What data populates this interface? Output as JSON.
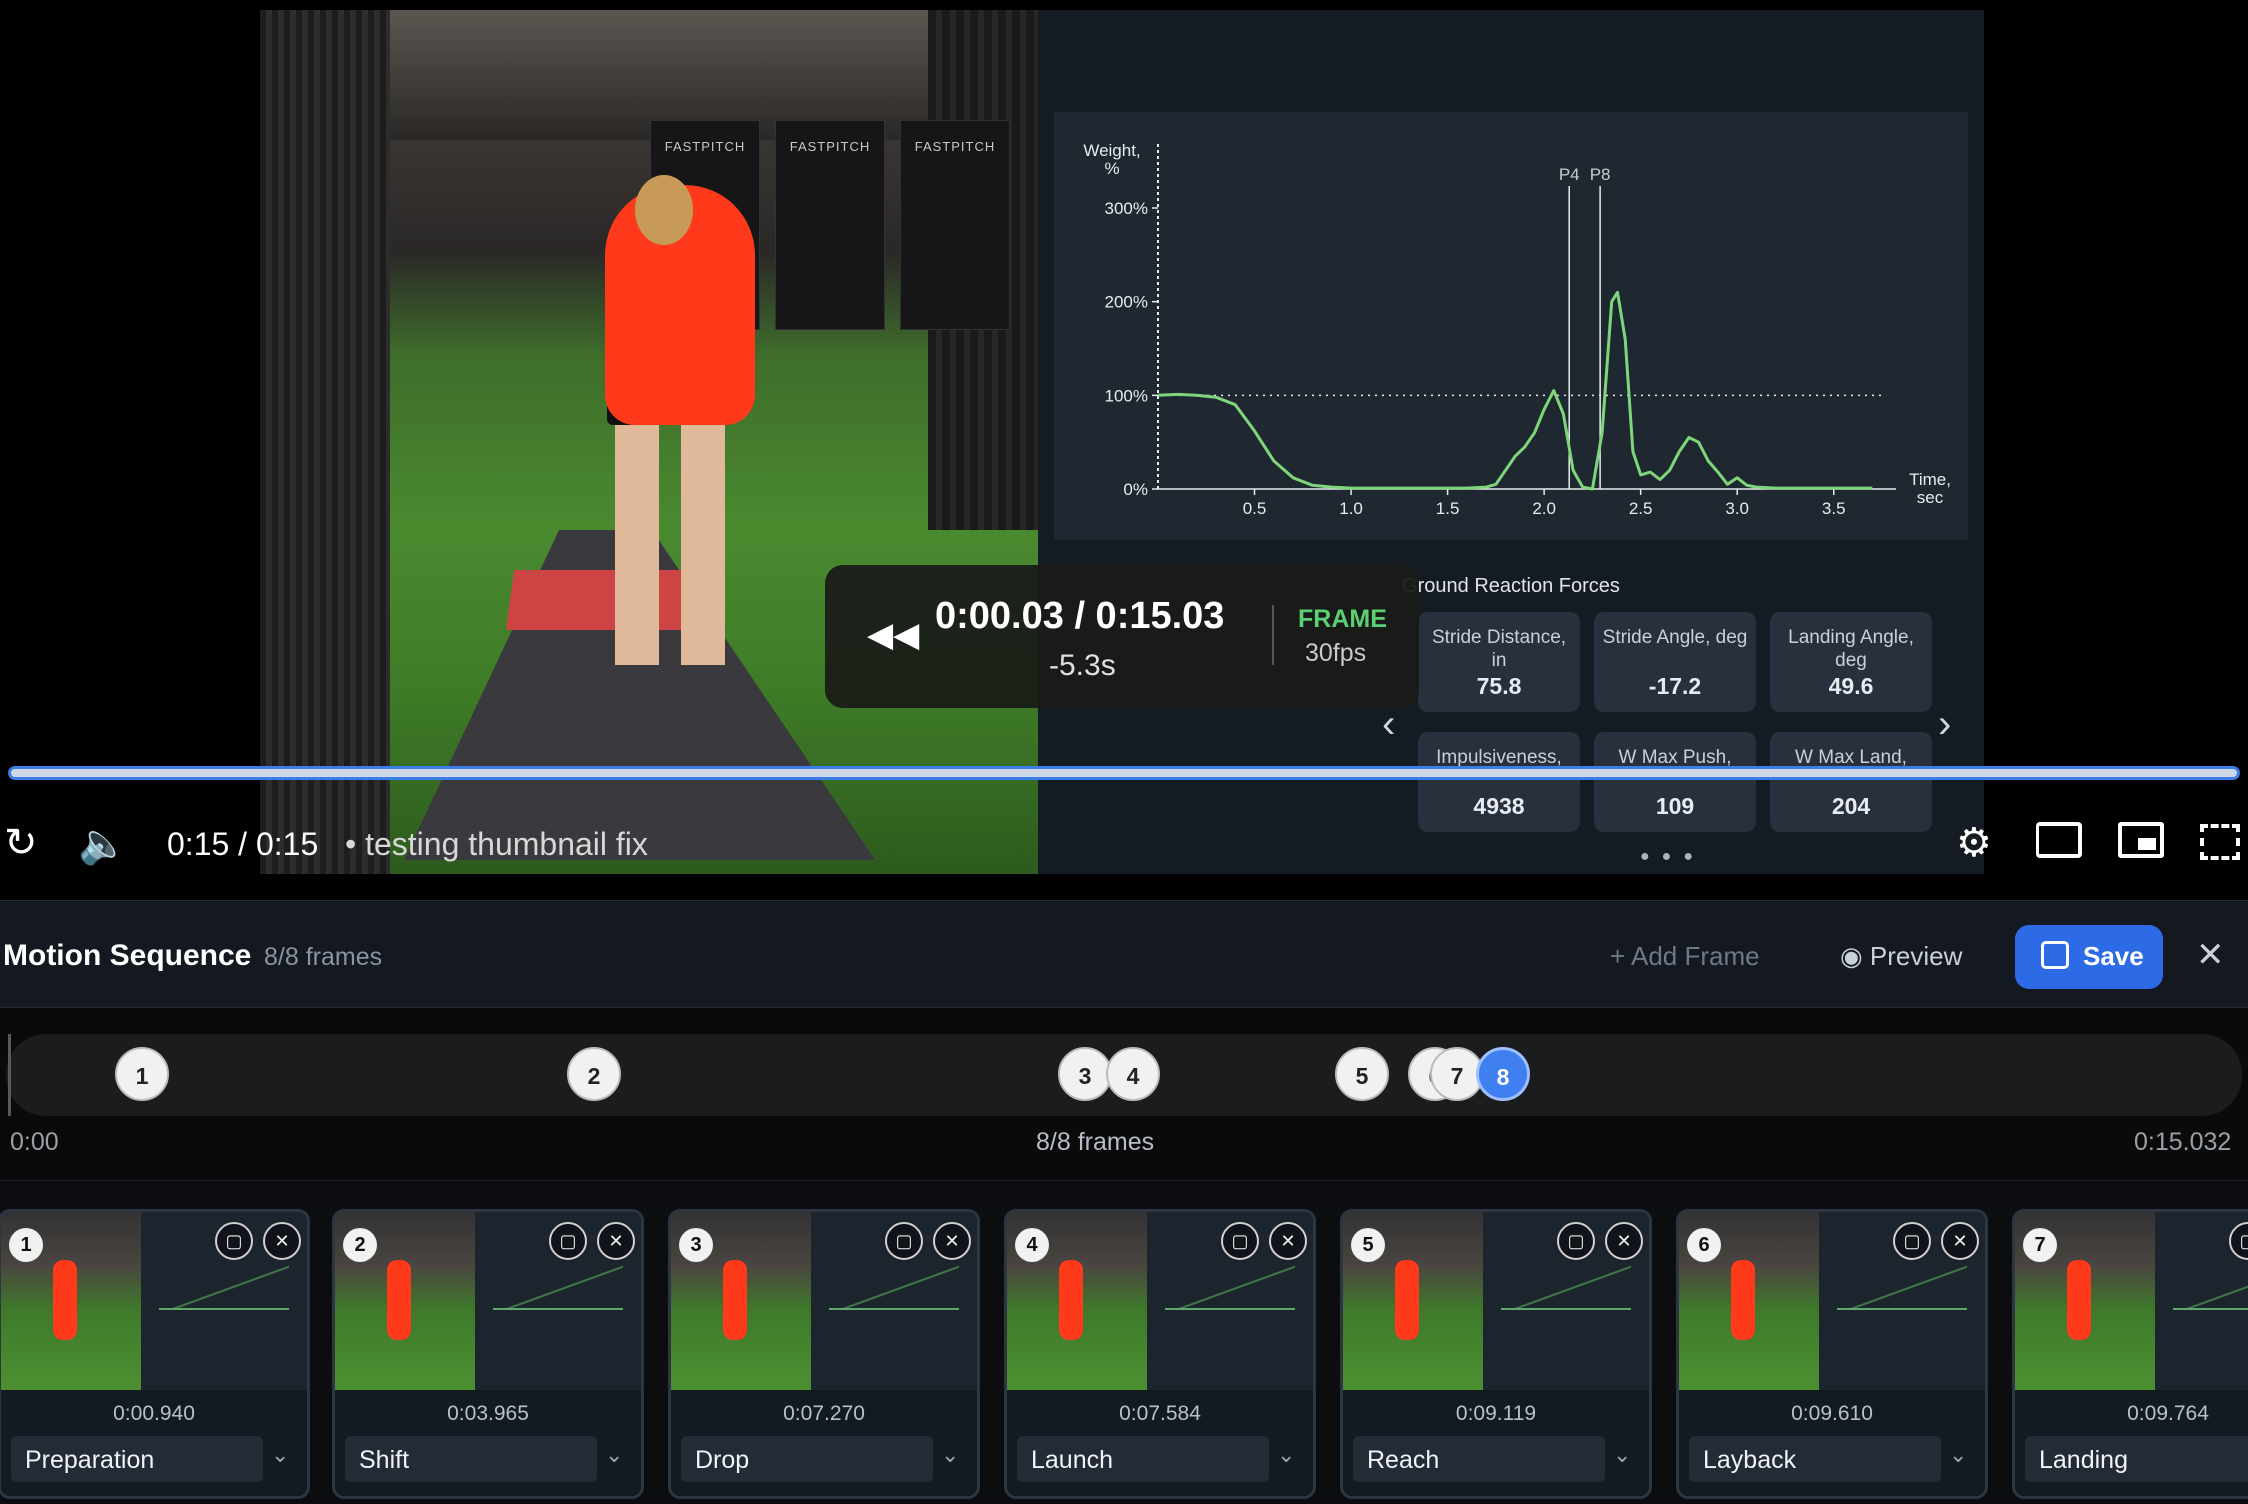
{
  "video": {
    "banners": [
      "FASTPITCH",
      "FASTPITCH",
      "FASTPITCH"
    ]
  },
  "chart_data": {
    "type": "line",
    "title": "",
    "ylabel": "Weight, %",
    "xlabel": "Time, sec",
    "ylim": [
      0,
      300
    ],
    "xlim": [
      0,
      3.75
    ],
    "x_ticks": [
      "0.5",
      "1.0",
      "1.5",
      "2.0",
      "2.5",
      "3.0",
      "3.5"
    ],
    "y_ticks": [
      "0%",
      "100%",
      "200%",
      "300%"
    ],
    "reference_line": 100,
    "markers": [
      {
        "label": "P4",
        "x": 2.13
      },
      {
        "label": "P8",
        "x": 2.29
      }
    ],
    "series": [
      {
        "color": "#7fd67a",
        "x": [
          0.0,
          0.1,
          0.2,
          0.3,
          0.4,
          0.5,
          0.6,
          0.7,
          0.8,
          0.9,
          1.0,
          1.2,
          1.4,
          1.6,
          1.7,
          1.75,
          1.8,
          1.85,
          1.9,
          1.95,
          2.0,
          2.05,
          2.1,
          2.15,
          2.2,
          2.25,
          2.3,
          2.35,
          2.38,
          2.42,
          2.46,
          2.5,
          2.55,
          2.6,
          2.65,
          2.7,
          2.75,
          2.8,
          2.85,
          2.9,
          2.95,
          3.0,
          3.05,
          3.1,
          3.2,
          3.3,
          3.5,
          3.7
        ],
        "y": [
          100,
          101,
          100,
          98,
          90,
          62,
          30,
          12,
          4,
          2,
          1,
          1,
          1,
          1,
          2,
          5,
          20,
          35,
          45,
          60,
          85,
          105,
          80,
          20,
          2,
          0,
          60,
          200,
          210,
          160,
          40,
          15,
          18,
          10,
          20,
          40,
          55,
          50,
          30,
          18,
          5,
          12,
          4,
          2,
          1,
          1,
          1,
          1
        ]
      }
    ]
  },
  "grf": {
    "title": "Ground Reaction Forces",
    "metrics": [
      {
        "label": "Stride Distance, in",
        "value": "75.8"
      },
      {
        "label": "Stride Angle, deg",
        "value": "-17.2"
      },
      {
        "label": "Landing Angle, deg",
        "value": "49.6"
      },
      {
        "label": "Impulsiveness,",
        "value": "4938"
      },
      {
        "label": "W Max Push,",
        "value": "109"
      },
      {
        "label": "W Max Land,",
        "value": "204"
      }
    ]
  },
  "overlay": {
    "time": "0:00.03 / 0:15.03",
    "delta": "-5.3s",
    "frame_label": "FRAME",
    "fps": "30fps"
  },
  "player": {
    "time_current": "0:15",
    "time_total": "/ 0:15",
    "title": "• testing thumbnail fix"
  },
  "sequence": {
    "title": "Motion Sequence",
    "count": "8/8 frames",
    "add_frame": "Add Frame",
    "preview": "Preview",
    "save": "Save"
  },
  "timeline": {
    "start": "0:00",
    "middle": "8/8 frames",
    "end": "0:15.032",
    "markers": [
      "1",
      "2",
      "3",
      "4",
      "5",
      "6",
      "7",
      "8"
    ],
    "active_marker": "8"
  },
  "frames": [
    {
      "num": "1",
      "time": "0:00.940",
      "phase": "Preparation"
    },
    {
      "num": "2",
      "time": "0:03.965",
      "phase": "Shift"
    },
    {
      "num": "3",
      "time": "0:07.270",
      "phase": "Drop"
    },
    {
      "num": "4",
      "time": "0:07.584",
      "phase": "Launch"
    },
    {
      "num": "5",
      "time": "0:09.119",
      "phase": "Reach"
    },
    {
      "num": "6",
      "time": "0:09.610",
      "phase": "Layback"
    },
    {
      "num": "7",
      "time": "0:09.764",
      "phase": "Landing"
    }
  ]
}
